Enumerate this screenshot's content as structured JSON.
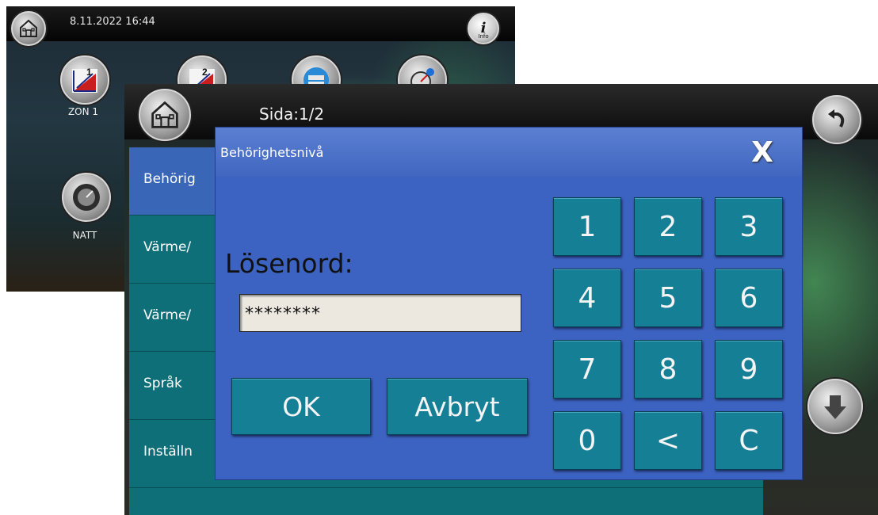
{
  "back_screen": {
    "datetime": "8.11.2022 16:44",
    "info_label": "Info",
    "zone1_label": "ZON 1",
    "zone1_badge": "1",
    "zone2_badge": "2",
    "natt_label": "NATT",
    "icons": [
      "home-icon",
      "info-icon",
      "zone1-chart-icon",
      "zone2-chart-icon",
      "tank-icon",
      "settings-gauge-icon",
      "night-dial-icon"
    ]
  },
  "front_screen": {
    "page_indicator": "Sida:1/2",
    "menu_items": [
      "Behörig",
      "Värme/",
      "Värme/",
      "Språk",
      "Inställn"
    ]
  },
  "dialog": {
    "title": "Behörighetsnivå",
    "close_label": "X",
    "password_label": "Lösenord:",
    "password_value": "********",
    "ok_label": "OK",
    "cancel_label": "Avbryt",
    "keypad": [
      "1",
      "2",
      "3",
      "4",
      "5",
      "6",
      "7",
      "8",
      "9",
      "0",
      "<",
      "C"
    ]
  },
  "colors": {
    "dialog_bg": "#3d63c2",
    "key_bg": "#157f96",
    "menu_bg": "#0f6f78",
    "menu_active": "#3a66b8"
  }
}
